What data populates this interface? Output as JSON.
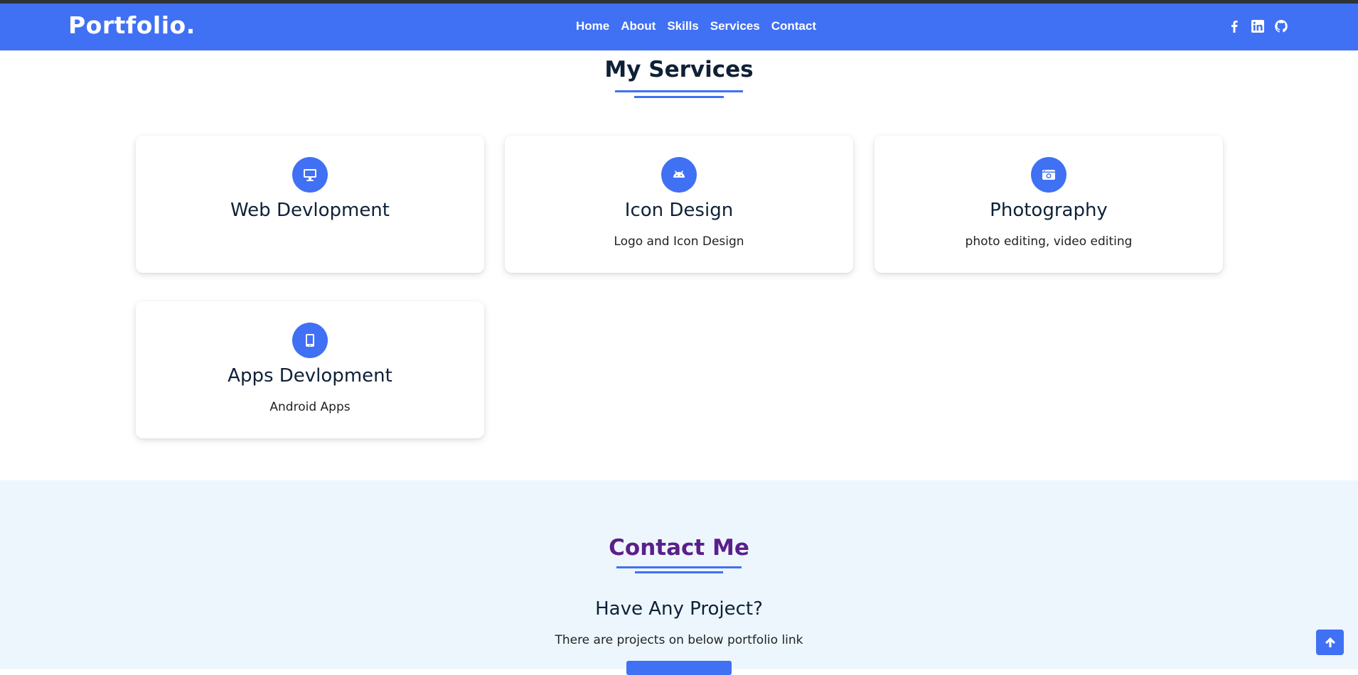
{
  "header": {
    "logo": "Portfolio.",
    "nav": [
      "Home",
      "About",
      "Skills",
      "Services",
      "Contact"
    ],
    "socials": [
      "facebook-icon",
      "linkedin-icon",
      "github-icon"
    ]
  },
  "services": {
    "title": "My Services",
    "cards": [
      {
        "icon": "desktop-icon",
        "title": "Web Devlopment",
        "desc": ""
      },
      {
        "icon": "android-icon",
        "title": "Icon Design",
        "desc": "Logo and Icon Design"
      },
      {
        "icon": "camera-icon",
        "title": "Photography",
        "desc": "photo editing, video editing"
      },
      {
        "icon": "tablet-icon",
        "title": "Apps Devlopment",
        "desc": "Android Apps"
      }
    ]
  },
  "contact": {
    "title": "Contact Me",
    "heading": "Have Any Project?",
    "text": "There are projects on below portfolio link"
  },
  "colors": {
    "accent": "#4070f4",
    "contact_title": "#5b1f8a",
    "contact_bg": "#edf6fd"
  }
}
